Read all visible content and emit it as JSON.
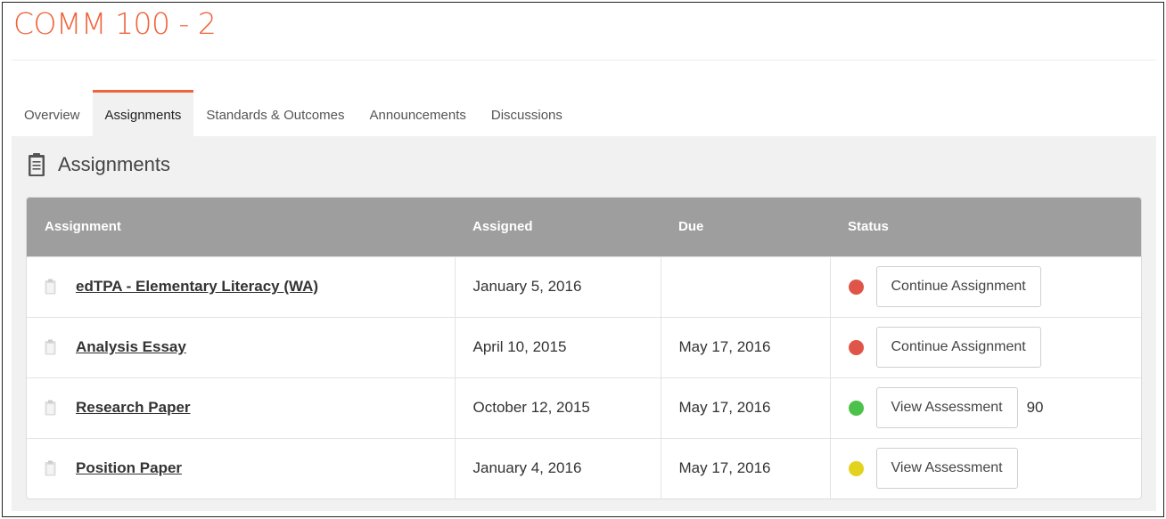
{
  "course": {
    "title": "COMM 100 - 2"
  },
  "tabs": [
    {
      "label": "Overview",
      "active": false
    },
    {
      "label": "Assignments",
      "active": true
    },
    {
      "label": "Standards & Outcomes",
      "active": false
    },
    {
      "label": "Announcements",
      "active": false
    },
    {
      "label": "Discussions",
      "active": false
    }
  ],
  "section": {
    "title": "Assignments",
    "icon": "clipboard-icon"
  },
  "table": {
    "headers": {
      "assignment": "Assignment",
      "assigned": "Assigned",
      "due": "Due",
      "status": "Status"
    },
    "rows": [
      {
        "name": "edTPA - Elementary Literacy (WA)",
        "assigned": "January 5, 2016",
        "due": "",
        "status_color": "#e05549",
        "button": "Continue Assignment",
        "score": ""
      },
      {
        "name": "Analysis Essay",
        "assigned": "April 10, 2015",
        "due": "May 17, 2016",
        "status_color": "#e05549",
        "button": "Continue Assignment",
        "score": ""
      },
      {
        "name": "Research Paper",
        "assigned": "October 12, 2015",
        "due": "May 17, 2016",
        "status_color": "#4cc24a",
        "button": "View Assessment",
        "score": "90"
      },
      {
        "name": "Position Paper",
        "assigned": "January 4, 2016",
        "due": "May 17, 2016",
        "status_color": "#e3d21e",
        "button": "View Assessment",
        "score": ""
      }
    ]
  },
  "colors": {
    "accent": "#f0643c",
    "header_bg": "#9e9e9e",
    "panel_bg": "#f1f1f1"
  }
}
